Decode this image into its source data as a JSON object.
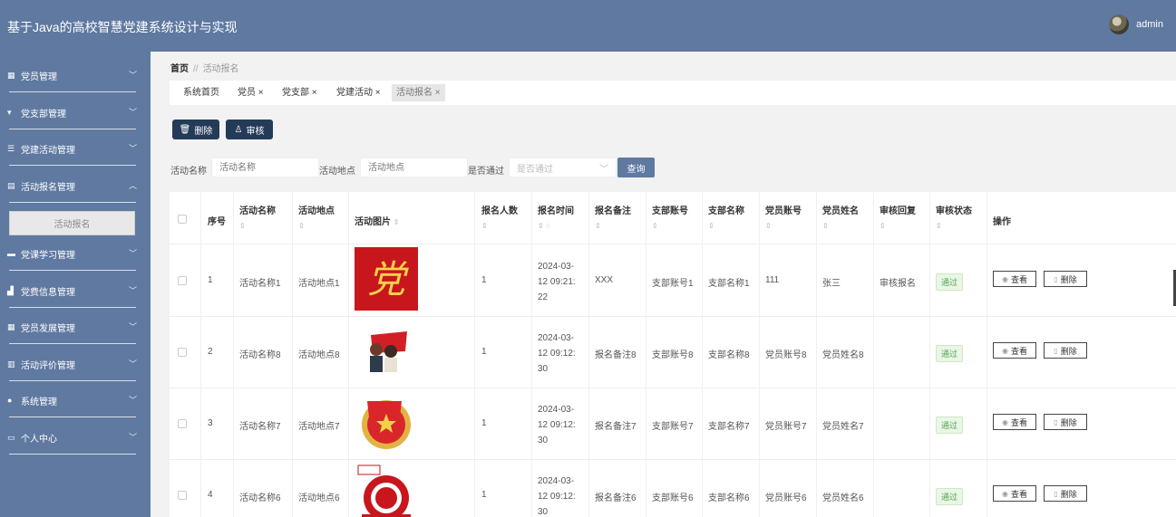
{
  "header": {
    "app_title": "基于Java的高校智慧党建系统设计与实现",
    "user": "admin"
  },
  "sidebar": {
    "items": [
      {
        "label": "党员管理",
        "icon": "grid-icon"
      },
      {
        "label": "党支部管理",
        "icon": "stand-icon"
      },
      {
        "label": "党建活动管理",
        "icon": "sliders-icon"
      },
      {
        "label": "活动报名管理",
        "icon": "document-icon"
      },
      {
        "label": "党课学习管理",
        "icon": "card-icon"
      },
      {
        "label": "党费信息管理",
        "icon": "like-icon"
      },
      {
        "label": "党员发展管理",
        "icon": "grid-icon"
      },
      {
        "label": "活动评价管理",
        "icon": "chart-icon"
      },
      {
        "label": "系统管理",
        "icon": "user-icon"
      },
      {
        "label": "个人中心",
        "icon": "monitor-icon"
      }
    ],
    "sub_item": "活动报名"
  },
  "breadcrumb": {
    "home": "首页",
    "sep": "//",
    "current": "活动报名"
  },
  "tags": [
    {
      "label": "系统首页"
    },
    {
      "label": "党员 ×"
    },
    {
      "label": "党支部 ×"
    },
    {
      "label": "党建活动 ×"
    },
    {
      "label": "活动报名 ×"
    }
  ],
  "actions": {
    "delete": "删除",
    "audit": "审核"
  },
  "filters": {
    "activity_name_label": "活动名称",
    "activity_name_placeholder": "活动名称",
    "activity_place_label": "活动地点",
    "activity_place_placeholder": "活动地点",
    "passed_label": "是否通过",
    "passed_placeholder": "是否通过",
    "query": "查询"
  },
  "table": {
    "columns": [
      "序号",
      "活动名称",
      "活动地点",
      "活动图片",
      "报名人数",
      "报名时间",
      "报名备注",
      "支部账号",
      "支部名称",
      "党员账号",
      "党员姓名",
      "审核回复",
      "审核状态",
      "操作"
    ],
    "rows": [
      {
        "no": "1",
        "name": "活动名称1",
        "place": "活动地点1",
        "image": "party-emblem",
        "count": "1",
        "time_l1": "2024-03-",
        "time_l2": "12 09:21:",
        "time_l3": "22",
        "remark": "XXX",
        "branch_acc": "支部账号1",
        "branch_name": "支部名称1",
        "member_acc": "111",
        "member_name": "张三",
        "reply": "审核报名",
        "status": "通过"
      },
      {
        "no": "2",
        "name": "活动名称8",
        "place": "活动地点8",
        "image": "flag-people",
        "count": "1",
        "time_l1": "2024-03-",
        "time_l2": "12 09:12:",
        "time_l3": "30",
        "remark": "报名备注8",
        "branch_acc": "支部账号8",
        "branch_name": "支部名称8",
        "member_acc": "党员账号8",
        "member_name": "党员姓名8",
        "reply": "",
        "status": "通过"
      },
      {
        "no": "3",
        "name": "活动名称7",
        "place": "活动地点7",
        "image": "youth-league-emblem",
        "count": "1",
        "time_l1": "2024-03-",
        "time_l2": "12 09:12:",
        "time_l3": "30",
        "remark": "报名备注7",
        "branch_acc": "支部账号7",
        "branch_name": "支部名称7",
        "member_acc": "党员账号7",
        "member_name": "党员姓名7",
        "reply": "",
        "status": "通过"
      },
      {
        "no": "4",
        "name": "活动名称6",
        "place": "活动地点6",
        "image": "papercut-poster",
        "count": "1",
        "time_l1": "2024-03-",
        "time_l2": "12 09:12:",
        "time_l3": "30",
        "remark": "报名备注6",
        "branch_acc": "支部账号6",
        "branch_name": "支部名称6",
        "member_acc": "党员账号6",
        "member_name": "党员姓名6",
        "reply": "",
        "status": "通过"
      }
    ],
    "view_label": "查看",
    "delete_label": "删除"
  },
  "colors": {
    "sidebar": "#5f79a1",
    "dark_button": "#243b58",
    "status_green": "#52a652"
  }
}
